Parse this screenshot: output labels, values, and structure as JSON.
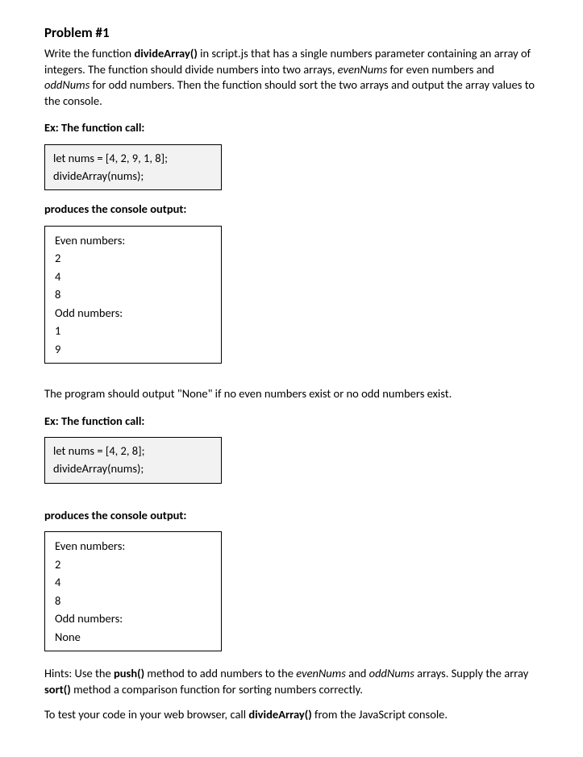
{
  "title": "Problem #1",
  "intro1": "Write the function ",
  "introBold1": "divideArray()",
  "intro2": " in script.js that has a single numbers parameter containing an array of integers. The function should divide numbers into two arrays, ",
  "introItalic1": "evenNums",
  "intro3": " for even numbers and ",
  "introItalic2": "oddNums",
  "intro4": " for odd numbers. Then the function should sort the two arrays and output the array values to the console.",
  "exLabel": "Ex: The function call:",
  "code1line1": "let nums = [4, 2, 9, 1, 8];",
  "code1line2": "divideArray(nums);",
  "producesLabel": "produces the console output:",
  "out1": {
    "l1": "Even numbers:",
    "l2": "2",
    "l3": "4",
    "l4": "8",
    "l5": "Odd numbers:",
    "l6": "1",
    "l7": "9"
  },
  "noneText": "The program should output \"None\" if no even numbers exist or no odd numbers exist.",
  "code2line1": "let nums = [4, 2, 8];",
  "code2line2": "divideArray(nums);",
  "out2": {
    "l1": "Even numbers:",
    "l2": "2",
    "l3": "4",
    "l4": "8",
    "l5": "Odd numbers:",
    "l6": "None"
  },
  "hints1": "Hints: Use the ",
  "hintsBold1": "push()",
  "hints2": " method to add numbers to the ",
  "hintsItalic1": "evenNums",
  "hints3": " and ",
  "hintsItalic2": "oddNums",
  "hints4": " arrays. Supply the array ",
  "hintsBold2": "sort()",
  "hints5": " method a comparison function for sorting numbers correctly.",
  "test1": "To test your code in your web browser, call ",
  "testBold": "divideArray()",
  "test2": " from the JavaScript console."
}
